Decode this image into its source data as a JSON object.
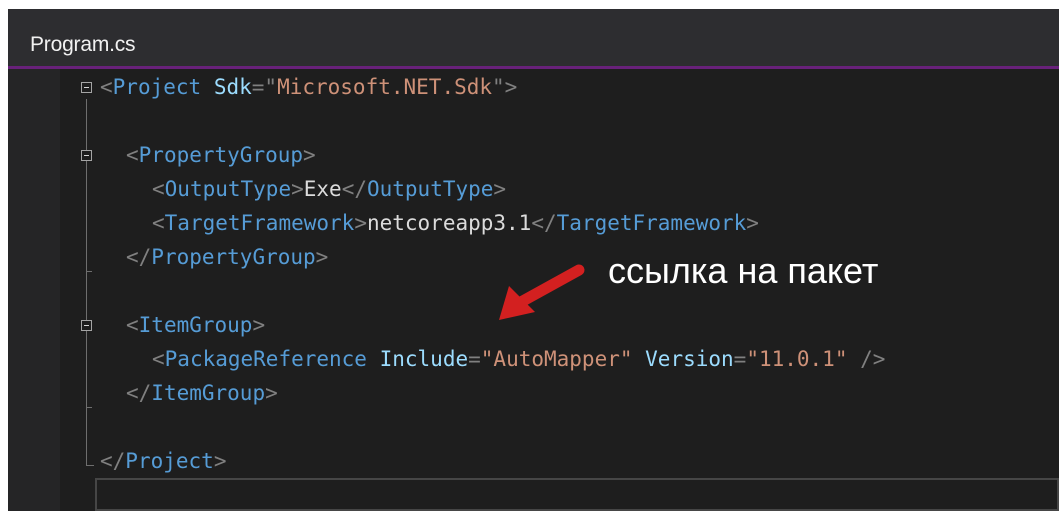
{
  "tab": {
    "title": "Program.cs"
  },
  "code": {
    "line1": {
      "lt": "<",
      "tag": "Project",
      "attr": "Sdk",
      "eq": "=",
      "q1": "\"",
      "val": "Microsoft.NET.Sdk",
      "q2": "\"",
      "gt": ">"
    },
    "line3": {
      "lt": "<",
      "tag": "PropertyGroup",
      "gt": ">"
    },
    "line4": {
      "lt": "<",
      "tag": "OutputType",
      "gt": ">",
      "text": "Exe",
      "clt": "</",
      "ctag": "OutputType",
      "cgt": ">"
    },
    "line5": {
      "lt": "<",
      "tag": "TargetFramework",
      "gt": ">",
      "text": "netcoreapp3.1",
      "clt": "</",
      "ctag": "TargetFramework",
      "cgt": ">"
    },
    "line6": {
      "lt": "</",
      "tag": "PropertyGroup",
      "gt": ">"
    },
    "line8": {
      "lt": "<",
      "tag": "ItemGroup",
      "gt": ">"
    },
    "line9": {
      "lt": "<",
      "tag": "PackageReference",
      "attr1": "Include",
      "eq1": "=",
      "val1": "\"AutoMapper\"",
      "attr2": "Version",
      "eq2": "=",
      "val2": "\"11.0.1\"",
      "close": "/>"
    },
    "line10": {
      "lt": "</",
      "tag": "ItemGroup",
      "gt": ">"
    },
    "line12": {
      "lt": "</",
      "tag": "Project",
      "gt": ">"
    }
  },
  "annotation": {
    "text": "ссылка на пакет",
    "arrow_icon": "arrow-pointer-icon",
    "color": "#d32020"
  },
  "colors": {
    "background": "#1e1e1e",
    "tab_accent": "#68217a",
    "tag": "#569cd6",
    "attribute": "#9cdcfe",
    "value": "#ce9178",
    "punctuation": "#808080"
  }
}
